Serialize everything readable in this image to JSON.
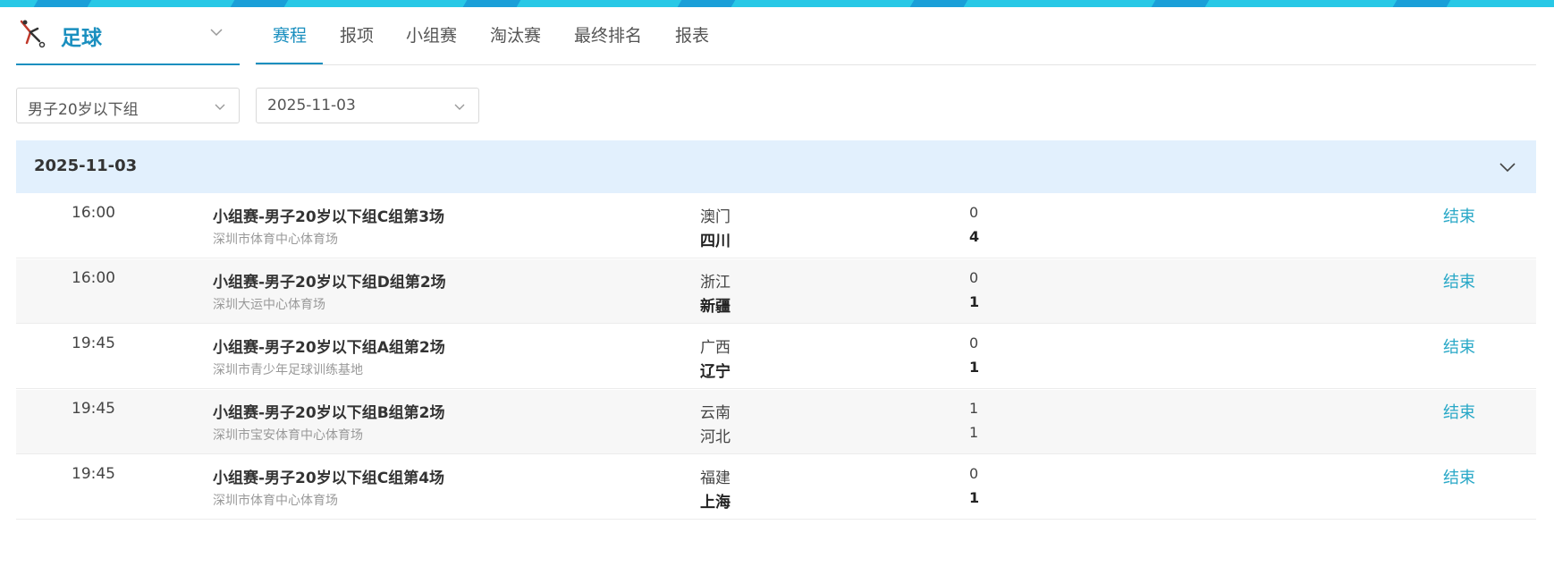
{
  "sport": {
    "name": "足球",
    "logo_icon": "football-player-icon",
    "dropdown_icon": "chevron-down-icon"
  },
  "tabs": [
    {
      "label": "赛程",
      "active": true
    },
    {
      "label": "报项",
      "active": false
    },
    {
      "label": "小组赛",
      "active": false
    },
    {
      "label": "淘汰赛",
      "active": false
    },
    {
      "label": "最终排名",
      "active": false
    },
    {
      "label": "报表",
      "active": false
    }
  ],
  "filters": {
    "group": {
      "value": "男子20岁以下组"
    },
    "date": {
      "value": "2025-11-03"
    }
  },
  "schedule": {
    "date": "2025-11-03",
    "collapse_icon": "chevron-down-icon",
    "matches": [
      {
        "time": "16:00",
        "title": "小组赛-男子20岁以下组C组第3场",
        "venue": "深圳市体育中心体育场",
        "home": "澳门",
        "home_score": "0",
        "away": "四川",
        "away_score": "4",
        "winner": "away",
        "status": "结束"
      },
      {
        "time": "16:00",
        "title": "小组赛-男子20岁以下组D组第2场",
        "venue": "深圳大运中心体育场",
        "home": "浙江",
        "home_score": "0",
        "away": "新疆",
        "away_score": "1",
        "winner": "away",
        "status": "结束"
      },
      {
        "time": "19:45",
        "title": "小组赛-男子20岁以下组A组第2场",
        "venue": "深圳市青少年足球训练基地",
        "home": "广西",
        "home_score": "0",
        "away": "辽宁",
        "away_score": "1",
        "winner": "away",
        "status": "结束"
      },
      {
        "time": "19:45",
        "title": "小组赛-男子20岁以下组B组第2场",
        "venue": "深圳市宝安体育中心体育场",
        "home": "云南",
        "home_score": "1",
        "away": "河北",
        "away_score": "1",
        "winner": "none",
        "status": "结束"
      },
      {
        "time": "19:45",
        "title": "小组赛-男子20岁以下组C组第4场",
        "venue": "深圳市体育中心体育场",
        "home": "福建",
        "home_score": "0",
        "away": "上海",
        "away_score": "1",
        "winner": "away",
        "status": "结束"
      }
    ]
  },
  "colors": {
    "accent": "#1a8fbf",
    "status": "#29a8c7",
    "date_header_bg": "#e2f0fd",
    "top_band": "#28c8e6"
  }
}
